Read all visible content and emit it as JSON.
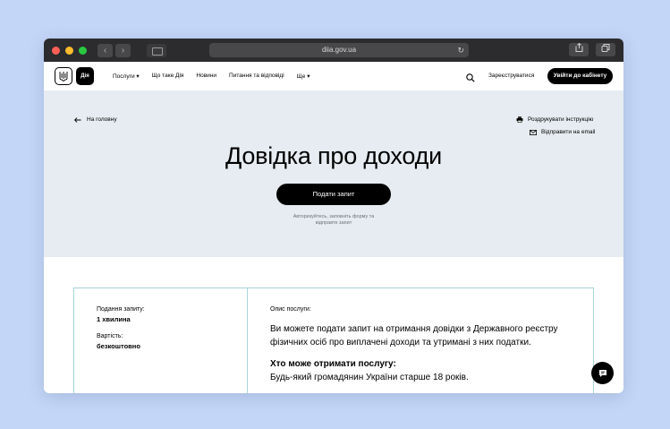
{
  "browser": {
    "url": "diia.gov.ua",
    "back_glyph": "‹",
    "forward_glyph": "›"
  },
  "header": {
    "logo_text": "Дія",
    "menu": [
      {
        "label": "Послуги"
      },
      {
        "label": "Що таке Дія"
      },
      {
        "label": "Новини"
      },
      {
        "label": "Питання та відповіді"
      },
      {
        "label": "Ще"
      }
    ],
    "register_label": "Зареєструватися",
    "login_label": "Увійти до кабінету"
  },
  "hero": {
    "back_label": "На головну",
    "print_label": "Роздрукувати інструкцію",
    "email_label": "Відправити на email",
    "title": "Довідка про доходи",
    "submit_label": "Подати запит",
    "hint_line1": "Авторизуйтесь, заповніть форму та",
    "hint_line2": "відправте запит"
  },
  "card": {
    "time_label": "Подання запиту:",
    "time_value": "1 хвилина",
    "cost_label": "Вартість:",
    "cost_value": "безкоштовно",
    "description_label": "Опис послуги:",
    "description": "Ви можете подати запит на отримання довідки з Державного реєстру фізичних осіб про виплачені доходи та утримані з них податки.",
    "who_title": "Хто може отримати послугу:",
    "who_text": "Будь-який громадянин України старше 18 років."
  },
  "colors": {
    "page_bg": "#c4d6f7",
    "hero_bg": "#e6ecf1",
    "card_border": "#a9d3db",
    "primary": "#000000"
  }
}
